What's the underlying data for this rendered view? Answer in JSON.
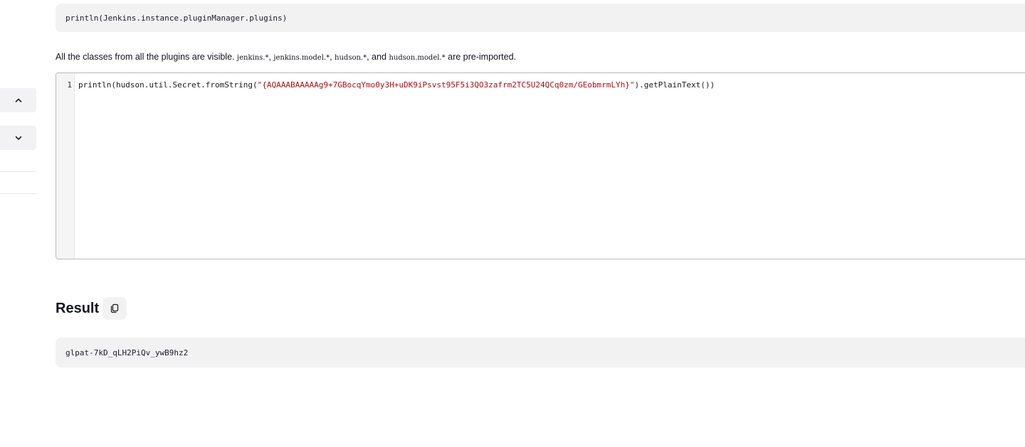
{
  "nav": {
    "up_icon": "chevron-up-icon",
    "down_icon": "chevron-down-icon"
  },
  "example": {
    "code": "println(Jenkins.instance.pluginManager.plugins)"
  },
  "help": {
    "prefix": "All the classes from all the plugins are visible. ",
    "pkg1": "jenkins.*",
    "sep1": ", ",
    "pkg2": "jenkins.model.*",
    "sep2": ", ",
    "pkg3": "hudson.*",
    "sep3": ", and ",
    "pkg4": "hudson.model.*",
    "suffix": " are pre-imported."
  },
  "editor": {
    "line_number": "1",
    "code_before": "println(hudson.util.Secret.fromString(",
    "code_string": "\"{AQAAABAAAAAg9+7GBocqYmo0y3H+uDK9iPsvst95F5i3QO3zafrm2TC5U24QCq0zm/GEobmrmLYh}\"",
    "code_after": ").getPlainText())"
  },
  "result": {
    "title": "Result",
    "copy_icon": "copy-icon",
    "output": "glpat-7kD_qLH2PiQv_ywB9hz2"
  },
  "colors": {
    "block_bg": "#f2f2f3",
    "string": "#aa1111",
    "text": "#14141f"
  }
}
